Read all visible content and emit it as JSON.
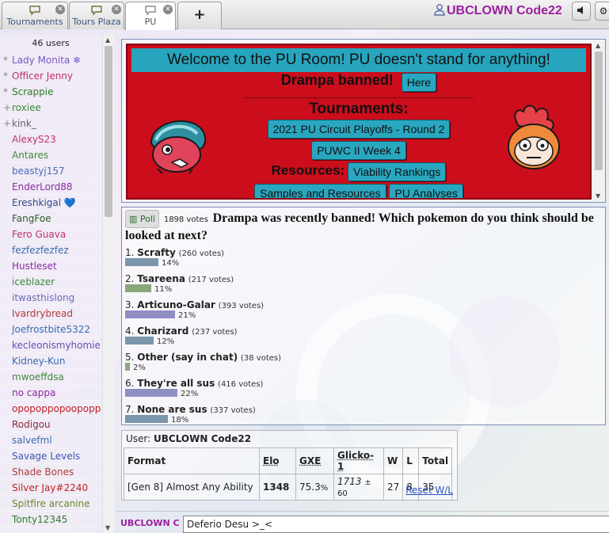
{
  "tabs": [
    {
      "label": "Tournaments",
      "icon": "chat-bubble-icon",
      "active": false
    },
    {
      "label": "Tours Plaza",
      "icon": "chat-bubble-icon",
      "active": false
    },
    {
      "label": "PU",
      "icon": "chat-bubble-icon",
      "active": true
    },
    {
      "label": "+",
      "icon": "plus-icon",
      "active": false
    }
  ],
  "header": {
    "username": "UBCLOWN Code22",
    "username_color": "#9c1ea0"
  },
  "userlist": {
    "count_label": "46 users",
    "users": [
      {
        "rank": "*",
        "name": "Lady Monita ❄",
        "color": "#7a55c8"
      },
      {
        "rank": "*",
        "name": "Officer Jenny",
        "color": "#c0306a"
      },
      {
        "rank": "*",
        "name": "Scrappie",
        "color": "#2f7a2a"
      },
      {
        "rank": "+",
        "name": "roxiee",
        "color": "#3c8a3c"
      },
      {
        "rank": "+",
        "name": "kink_",
        "color": "#666666"
      },
      {
        "rank": "",
        "name": "AlexyS23",
        "color": "#c0306a"
      },
      {
        "rank": "",
        "name": "Antares",
        "color": "#3c8a3c"
      },
      {
        "rank": "",
        "name": "beastyj157",
        "color": "#4a6ab8"
      },
      {
        "rank": "",
        "name": "EnderLord88",
        "color": "#8a2aa0"
      },
      {
        "rank": "",
        "name": "Ereshkigal 💙",
        "color": "#2f4a8a"
      },
      {
        "rank": "",
        "name": "FangFoe",
        "color": "#2f5a2a"
      },
      {
        "rank": "",
        "name": "Fero Guava",
        "color": "#c0306a"
      },
      {
        "rank": "",
        "name": "fezfezfezfez",
        "color": "#3a6ab0"
      },
      {
        "rank": "",
        "name": "Hustleset",
        "color": "#8a2aa0"
      },
      {
        "rank": "",
        "name": "iceblazer",
        "color": "#3c8a3c"
      },
      {
        "rank": "",
        "name": "itwasthislong",
        "color": "#6a6ab8"
      },
      {
        "rank": "",
        "name": "Ivardrybread",
        "color": "#b03a3a"
      },
      {
        "rank": "",
        "name": "Joefrostbite5322",
        "color": "#3a6ab0"
      },
      {
        "rank": "",
        "name": "kecleonismyhomie",
        "color": "#6a4ab0"
      },
      {
        "rank": "",
        "name": "Kidney-Kun",
        "color": "#3a6ab0"
      },
      {
        "rank": "",
        "name": "mwoeffdsa",
        "color": "#3c8a3c"
      },
      {
        "rank": "",
        "name": "no cappa",
        "color": "#8a2aa0"
      },
      {
        "rank": "",
        "name": "opopoppopoopoppo",
        "color": "#c02020"
      },
      {
        "rank": "",
        "name": "Rodigou",
        "color": "#8a2a40"
      },
      {
        "rank": "",
        "name": "salvefml",
        "color": "#3a6ab0"
      },
      {
        "rank": "",
        "name": "Savage Levels",
        "color": "#3a5ab0"
      },
      {
        "rank": "",
        "name": "Shade Bones",
        "color": "#b03a3a"
      },
      {
        "rank": "",
        "name": "Silver Jay#2240",
        "color": "#c02020"
      },
      {
        "rank": "",
        "name": "Spitfire arcanine",
        "color": "#6a8a2a"
      },
      {
        "rank": "",
        "name": "Tonty12345",
        "color": "#2f7a2a"
      }
    ]
  },
  "banner": {
    "welcome": "Welcome to the PU Room! PU doesn't stand for anything!",
    "banned_text": "Drampa banned!",
    "here_button": "Here",
    "tournaments_heading": "Tournaments:",
    "tournament_links": [
      "2021 PU Circuit Playoffs - Round 2",
      "PUWC II Week 4"
    ],
    "resources_heading": "Resources:",
    "resource_links": [
      "Viability Rankings",
      "Samples and Resources",
      "PU Analyses"
    ],
    "bg_color": "#cc0d1c",
    "accent_color": "#27a5be"
  },
  "poll": {
    "badge": "Poll",
    "total_votes": "1898 votes",
    "question": "Drampa was recently banned! Which pokemon do you think should be looked at next?",
    "options": [
      {
        "num": "1.",
        "name": "Scrafty",
        "votes": "(260 votes)",
        "percent_label": "14%",
        "percent": 14,
        "color": "#7a96aa"
      },
      {
        "num": "2.",
        "name": "Tsareena",
        "votes": "(217 votes)",
        "percent_label": "11%",
        "percent": 11,
        "color": "#88a87a"
      },
      {
        "num": "3.",
        "name": "Articuno-Galar",
        "votes": "(393 votes)",
        "percent_label": "21%",
        "percent": 21,
        "color": "#8f8fc2"
      },
      {
        "num": "4.",
        "name": "Charizard",
        "votes": "(237 votes)",
        "percent_label": "12%",
        "percent": 12,
        "color": "#7a96aa"
      },
      {
        "num": "5.",
        "name": "Other (say in chat)",
        "votes": "(38 votes)",
        "percent_label": "2%",
        "percent": 2,
        "color": "#88a87a"
      },
      {
        "num": "6.",
        "name": "They're all sus",
        "votes": "(416 votes)",
        "percent_label": "22%",
        "percent": 22,
        "color": "#8f8fc2"
      },
      {
        "num": "7.",
        "name": "None are sus",
        "votes": "(337 votes)",
        "percent_label": "18%",
        "percent": 18,
        "color": "#7a96aa"
      }
    ]
  },
  "stats": {
    "user_prefix": "User:",
    "user": "UBCLOWN Code22",
    "headers": [
      "Format",
      "Elo",
      "GXE",
      "Glicko-1",
      "W",
      "L",
      "Total"
    ],
    "row": {
      "format": "[Gen 8] Almost Any Ability",
      "elo": "1348",
      "gxe": "75.3",
      "gxe_unit": "%",
      "glicko": "1713",
      "glicko_dev": "± 60",
      "w": "27",
      "l": "8",
      "total": "35"
    },
    "reset_link": "Reset W/L"
  },
  "compose": {
    "name": "UBCLOWN C",
    "value": "Deferio Desu >_<"
  }
}
